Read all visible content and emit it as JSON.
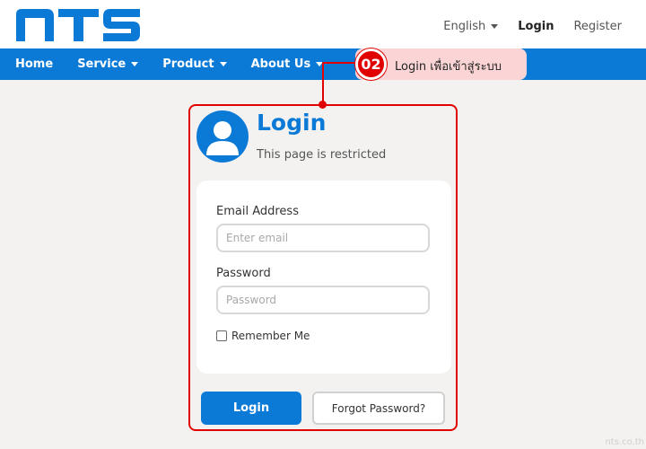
{
  "brand": {
    "logo_text": "NTS",
    "color": "#0b7ad6"
  },
  "header": {
    "language": "English",
    "login": "Login",
    "register": "Register"
  },
  "nav": {
    "items": [
      {
        "label": "Home",
        "has_dropdown": false
      },
      {
        "label": "Service",
        "has_dropdown": true
      },
      {
        "label": "Product",
        "has_dropdown": true
      },
      {
        "label": "About Us",
        "has_dropdown": true
      }
    ]
  },
  "callout": {
    "number": "02",
    "text": "Login เพื่อเข้าสู่ระบบ",
    "color": "#e00000"
  },
  "login": {
    "title": "Login",
    "subtitle": "This page is restricted",
    "avatar_icon": "user-icon",
    "email_label": "Email Address",
    "email_placeholder": "Enter email",
    "password_label": "Password",
    "password_placeholder": "Password",
    "remember_label": "Remember Me",
    "remember_checked": false,
    "login_button": "Login",
    "forgot_button": "Forgot Password?"
  },
  "watermark": "nts.co.th"
}
